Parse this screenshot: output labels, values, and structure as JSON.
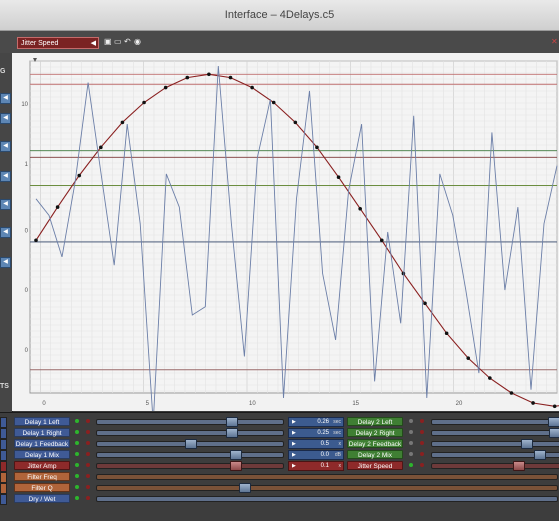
{
  "window": {
    "title": "Interface – 4Delays.c5"
  },
  "toolbar": {
    "preset_selector": "Jitter Speed",
    "icons": [
      "save-icon",
      "folder-icon",
      "undo-icon",
      "eye-icon"
    ]
  },
  "left_strip": {
    "labels": [
      "G",
      "TS"
    ]
  },
  "chart_data": {
    "type": "line",
    "y_tick_labels": [
      "10",
      "1",
      "0",
      "0",
      "0"
    ],
    "x": [
      0,
      5,
      10,
      15,
      20
    ],
    "x_tick_labels": [
      "0",
      "5",
      "10",
      "15",
      "20"
    ],
    "xlim": [
      -0.5,
      25
    ],
    "series": [
      {
        "color": "#8a2020",
        "values": [
          0.0,
          0.2,
          0.39,
          0.56,
          0.71,
          0.83,
          0.92,
          0.98,
          1.0,
          0.98,
          0.92,
          0.83,
          0.71,
          0.56,
          0.38,
          0.19,
          0.0,
          -0.2,
          -0.38,
          -0.56,
          -0.71,
          -0.83,
          -0.92,
          -0.98,
          -1.0,
          -0.98,
          -0.92,
          -0.83
        ]
      },
      {
        "color": "#6c7fa8",
        "values": [
          0.25,
          0.15,
          -0.1,
          0.35,
          0.95,
          0.4,
          -0.15,
          0.7,
          0.1,
          -1.1,
          0.4,
          0.2,
          -0.45,
          -0.4,
          1.05,
          0.1,
          -0.7,
          0.5,
          0.85,
          -0.95,
          0.25,
          0.9,
          -0.2,
          -0.6,
          0.3,
          0.7,
          -0.85,
          0.05,
          -0.5,
          0.75,
          -0.95,
          0.4,
          0.15,
          -0.3,
          -0.8,
          0.65,
          -0.3,
          0.2,
          -0.9,
          0.1,
          0.45
        ]
      }
    ],
    "grid": true
  },
  "controls": {
    "rows": [
      {
        "label": "Delay 1 Left",
        "color": "blue",
        "value": "0.26",
        "unit": "sec",
        "right_label": "Delay 2 Left",
        "right_color": "green"
      },
      {
        "label": "Delay 1 Right",
        "color": "blue",
        "value": "0.25",
        "unit": "sec",
        "right_label": "Delay 2 Right",
        "right_color": "green"
      },
      {
        "label": "Delay 1 Feedback",
        "color": "blue",
        "value": "0.5",
        "unit": "x",
        "right_label": "Delay 2 Feedback",
        "right_color": "green"
      },
      {
        "label": "Delay 1 Mix",
        "color": "blue",
        "value": "0.0",
        "unit": "dB",
        "right_label": "Delay 2 Mix",
        "right_color": "green"
      },
      {
        "label": "Jitter Amp",
        "color": "red",
        "value": "0.1",
        "unit": "x",
        "right_label": "Jitter Speed",
        "right_color": "red"
      },
      {
        "label": "Filter Freq",
        "color": "orange"
      },
      {
        "label": "Filter Q",
        "color": "orange"
      },
      {
        "label": "Dry / Wet",
        "color": "blue"
      }
    ]
  }
}
